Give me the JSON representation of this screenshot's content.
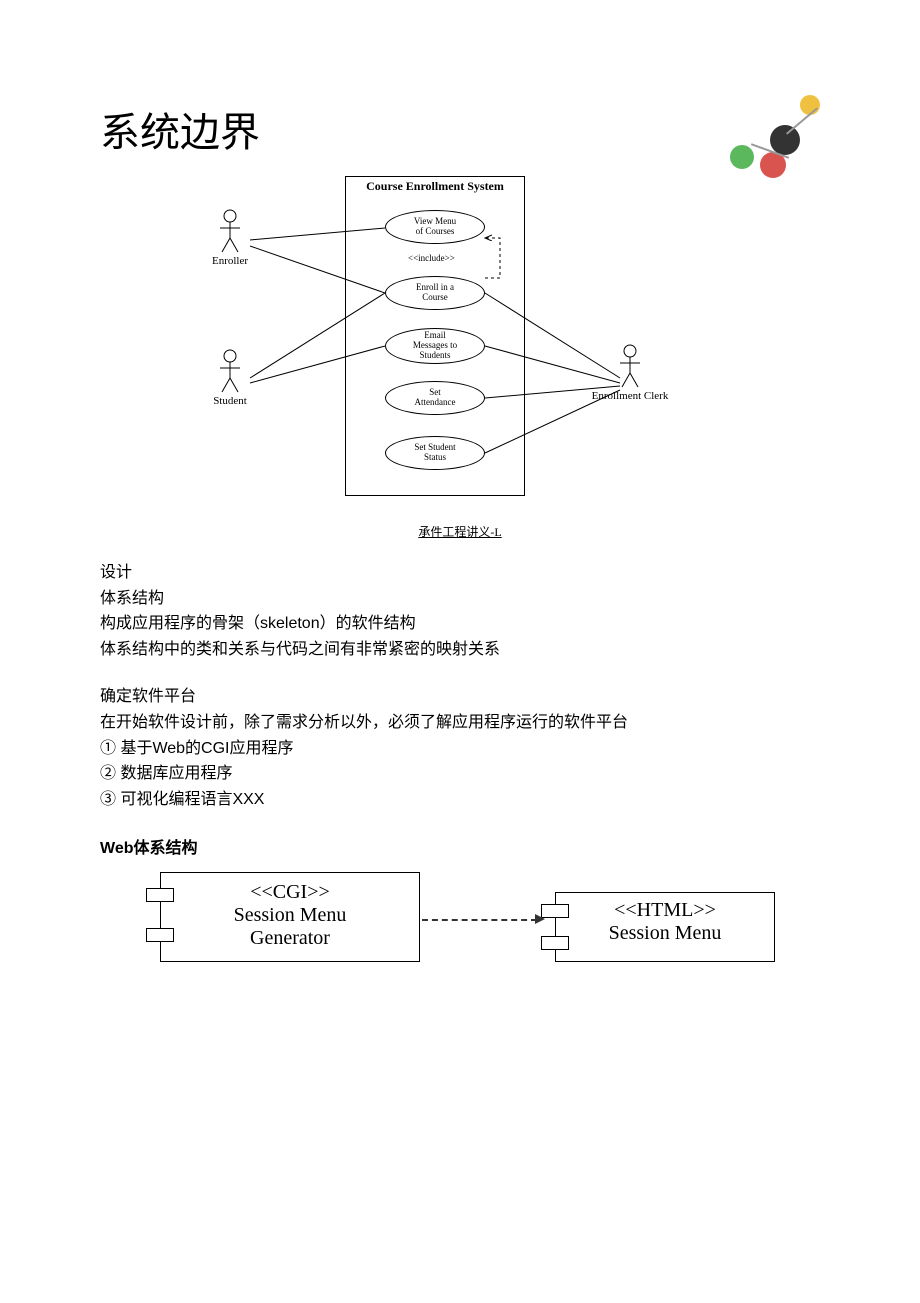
{
  "title": "系统边界",
  "decor_colors": {
    "green": "#5cb85c",
    "red": "#d9534f",
    "dark": "#333333",
    "yellow": "#f0c040"
  },
  "usecase_diagram": {
    "system_title": "Course Enrollment System",
    "actors": [
      {
        "id": "enroller",
        "label": "Enroller"
      },
      {
        "id": "student",
        "label": "Student"
      },
      {
        "id": "clerk",
        "label": "Enrollment Clerk"
      }
    ],
    "usecases": [
      {
        "id": "view",
        "label": "View Menu\nof Courses"
      },
      {
        "id": "enroll",
        "label": "Enroll in a\nCourse"
      },
      {
        "id": "email",
        "label": "Email\nMessages to\nStudents"
      },
      {
        "id": "attend",
        "label": "Set\nAttendance"
      },
      {
        "id": "status",
        "label": "Set Student\nStatus"
      }
    ],
    "include_label": "<<include>>"
  },
  "caption": "承件工程讲义-L",
  "sections": {
    "design": "设计",
    "arch": "体系结构",
    "arch_l1": "构成应用程序的骨架（skeleton）的软件结构",
    "arch_l2": "体系结构中的类和关系与代码之间有非常紧密的映射关系",
    "platform_h": "确定软件平台",
    "platform_l1": "在开始软件设计前，除了需求分析以外，必须了解应用程序运行的软件平台",
    "platform_i1": "①  基于Web的CGI应用程序",
    "platform_i2": "②  数据库应用程序",
    "platform_i3": "③  可视化编程语言XXX",
    "web_arch_h": "Web体系结构"
  },
  "web_arch": {
    "left_stereo": "<<CGI>>",
    "left_name": "Session Menu\nGenerator",
    "right_stereo": "<<HTML>>",
    "right_name": "Session Menu"
  }
}
